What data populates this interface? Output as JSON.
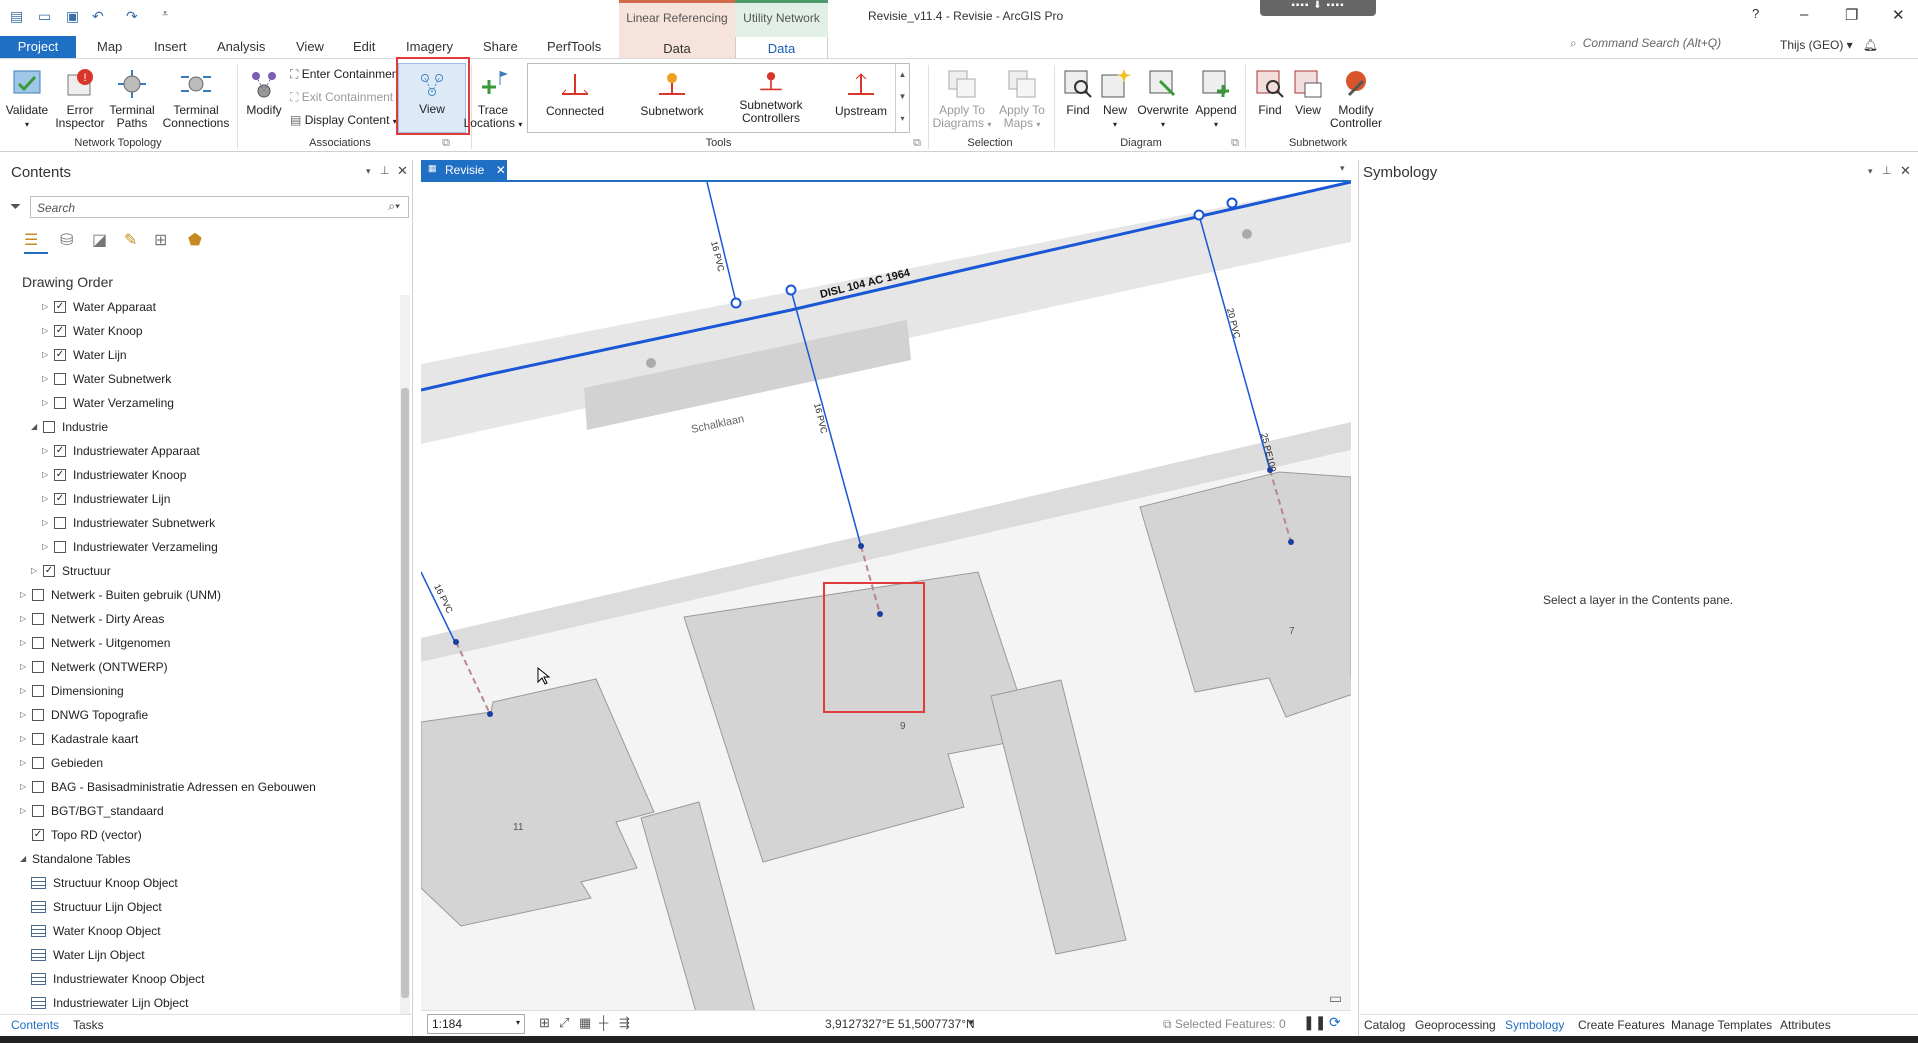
{
  "window": {
    "title": "Revisie_v11.4 - Revisie - ArcGIS Pro",
    "help": "?",
    "minimize": "–",
    "restore": "❐",
    "close": "✕"
  },
  "context_tabs": {
    "linear_referencing": {
      "group": "Linear Referencing",
      "tab": "Data"
    },
    "utility_network": {
      "group": "Utility Network",
      "tab": "Data"
    }
  },
  "tabs": [
    "Project",
    "Map",
    "Insert",
    "Analysis",
    "View",
    "Edit",
    "Imagery",
    "Share",
    "PerfTools"
  ],
  "command_search": {
    "placeholder": "Command Search (Alt+Q)"
  },
  "user": "Thijs (GEO)",
  "ribbon": {
    "network_topology": {
      "label": "Network Topology",
      "buttons": [
        "Validate",
        "Error\nInspector",
        "Terminal\nPaths",
        "Terminal\nConnections"
      ]
    },
    "associations": {
      "label": "Associations",
      "modify": "Modify",
      "enter_containment": "Enter Containment",
      "exit_containment": "Exit Containment",
      "display_content": "Display Content",
      "view": "View"
    },
    "trace": {
      "label": "Trace\nLocations"
    },
    "tools": {
      "label": "Tools",
      "items": [
        "Connected",
        "Subnetwork",
        "Subnetwork\nControllers",
        "Upstream"
      ]
    },
    "selection": {
      "label": "Selection",
      "apply_to_diagrams": "Apply To\nDiagrams",
      "apply_to_maps": "Apply To\nMaps"
    },
    "diagram": {
      "label": "Diagram",
      "buttons": [
        "Find",
        "New",
        "Overwrite",
        "Append"
      ]
    },
    "subnetwork": {
      "label": "Subnetwork",
      "buttons": [
        "Find",
        "View",
        "Modify\nController"
      ]
    }
  },
  "contents": {
    "title": "Contents",
    "search_placeholder": "Search",
    "drawing_order": "Drawing Order",
    "items": [
      {
        "label": "Water Apparaat",
        "level": 2,
        "checked": true,
        "expand": "▷"
      },
      {
        "label": "Water Knoop",
        "level": 2,
        "checked": true,
        "expand": "▷"
      },
      {
        "label": "Water Lijn",
        "level": 2,
        "checked": true,
        "expand": "▷"
      },
      {
        "label": "Water Subnetwerk",
        "level": 2,
        "checked": false,
        "expand": "▷"
      },
      {
        "label": "Water Verzameling",
        "level": 2,
        "checked": false,
        "expand": "▷"
      },
      {
        "label": "Industrie",
        "level": 1,
        "checked": false,
        "expand": "◢"
      },
      {
        "label": "Industriewater Apparaat",
        "level": 2,
        "checked": true,
        "expand": "▷"
      },
      {
        "label": "Industriewater Knoop",
        "level": 2,
        "checked": true,
        "expand": "▷"
      },
      {
        "label": "Industriewater Lijn",
        "level": 2,
        "checked": true,
        "expand": "▷"
      },
      {
        "label": "Industriewater Subnetwerk",
        "level": 2,
        "checked": false,
        "expand": "▷"
      },
      {
        "label": "Industriewater Verzameling",
        "level": 2,
        "checked": false,
        "expand": "▷"
      },
      {
        "label": "Structuur",
        "level": 1,
        "checked": true,
        "expand": "▷"
      },
      {
        "label": "Netwerk - Buiten gebruik (UNM)",
        "level": 0,
        "checked": false,
        "expand": "▷"
      },
      {
        "label": "Netwerk - Dirty Areas",
        "level": 0,
        "checked": false,
        "expand": "▷"
      },
      {
        "label": "Netwerk - Uitgenomen",
        "level": 0,
        "checked": false,
        "expand": "▷"
      },
      {
        "label": "Netwerk (ONTWERP)",
        "level": 0,
        "checked": false,
        "expand": "▷"
      },
      {
        "label": "Dimensioning",
        "level": 0,
        "checked": false,
        "expand": "▷"
      },
      {
        "label": "DNWG Topografie",
        "level": 0,
        "checked": false,
        "expand": "▷"
      },
      {
        "label": "Kadastrale kaart",
        "level": 0,
        "checked": false,
        "expand": "▷"
      },
      {
        "label": "Gebieden",
        "level": 0,
        "checked": false,
        "expand": "▷"
      },
      {
        "label": "BAG - Basisadministratie Adressen en Gebouwen",
        "level": 0,
        "checked": false,
        "expand": "▷"
      },
      {
        "label": "BGT/BGT_standaard",
        "level": 0,
        "checked": false,
        "expand": "▷"
      },
      {
        "label": "Topo RD (vector)",
        "level": 0,
        "checked": true,
        "expand": ""
      }
    ],
    "standalone_tables": {
      "label": "Standalone Tables",
      "items": [
        "Structuur Knoop Object",
        "Structuur Lijn Object",
        "Water Knoop Object",
        "Water Lijn Object",
        "Industriewater Knoop Object",
        "Industriewater Lijn Object"
      ]
    },
    "bottom_tabs": [
      "Contents",
      "Tasks"
    ]
  },
  "map": {
    "tab": "Revisie",
    "labels": {
      "main_line": "DISL 104 AC 1964",
      "street": "Schalklaan",
      "pipe_a": "16 PVC",
      "pipe_b": "16 PVC",
      "pipe_c": "20 PVC",
      "pipe_d": "25 PE100",
      "pipe_e": "16 PVC",
      "house_9": "9",
      "house_7": "7",
      "house_11": "11"
    },
    "scale": "1:184",
    "coordinates": "3,9127327°E 51,5007737°N",
    "selected_features": "Selected Features: 0"
  },
  "symbology": {
    "title": "Symbology",
    "message": "Select a layer in the Contents pane."
  },
  "bottom_tabs_right": [
    "Catalog",
    "Geoprocessing",
    "Symbology",
    "Create Features",
    "Manage Templates",
    "Attributes"
  ],
  "colors": {
    "accent": "#1f6fc4",
    "highlight": "#e03a3a",
    "pipe": "#1a57d6"
  }
}
